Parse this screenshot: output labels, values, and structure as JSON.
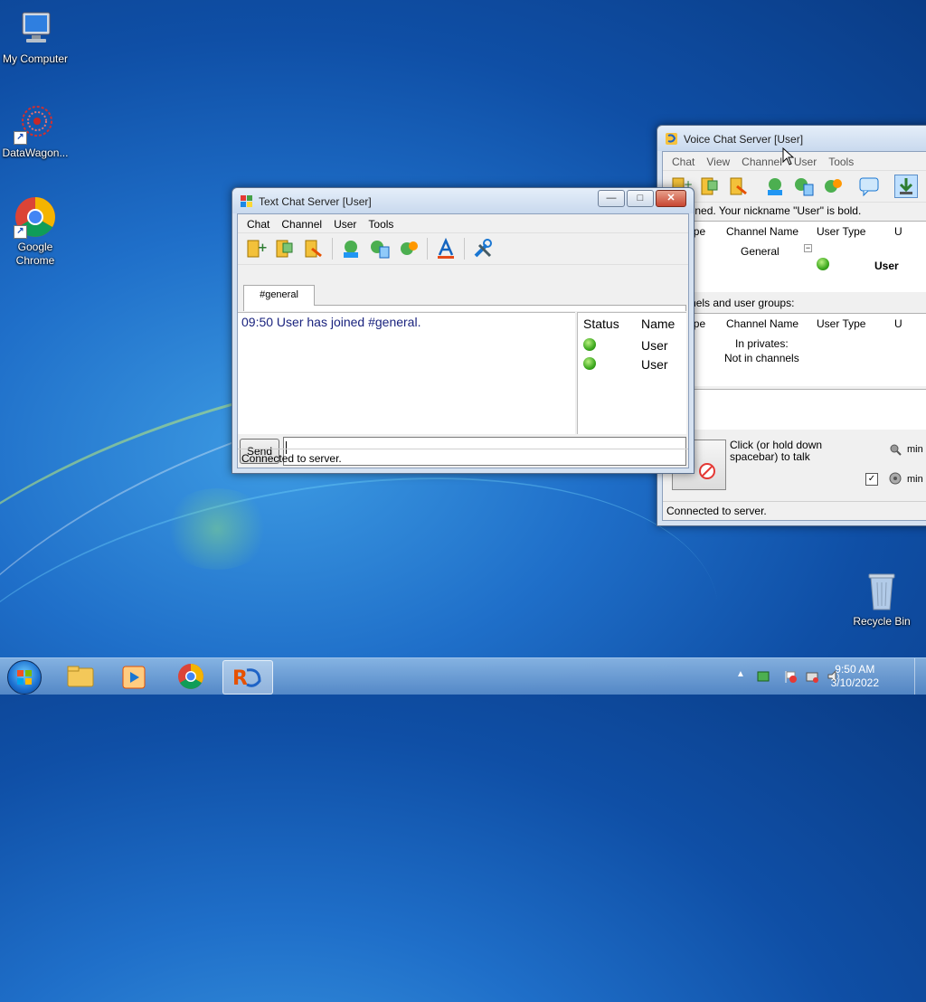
{
  "desktop": {
    "icons": [
      {
        "label": "My Computer"
      },
      {
        "label": "DataWagon..."
      },
      {
        "label": "Google Chrome"
      },
      {
        "label": "Recycle Bin"
      }
    ]
  },
  "text_chat": {
    "title": "Text Chat Server [User]",
    "menu": [
      "Chat",
      "Channel",
      "User",
      "Tools"
    ],
    "tab": "#general",
    "messages": [
      "09:50 User has joined #general."
    ],
    "users_header": {
      "status": "Status",
      "name": "Name"
    },
    "users": [
      {
        "name": "User"
      },
      {
        "name": "User"
      }
    ],
    "send_label": "Send",
    "input_value": "",
    "status": "Connected to server.",
    "window_buttons": {
      "minimize": "—",
      "maximize": "□",
      "close": "✕"
    }
  },
  "voice_chat": {
    "title": "Voice Chat Server [User]",
    "menu": [
      "Chat",
      "View",
      "Channel",
      "User",
      "Tools"
    ],
    "info_top": "nel joined. Your nickname \"User\" is bold.",
    "grid1_headers": {
      "type": "nel Type",
      "channel": "Channel Name",
      "user_type": "User Type",
      "extra": "U"
    },
    "grid1_channel": "General",
    "grid1_user": "User",
    "info_mid": "channels and user groups:",
    "grid2_headers": {
      "type": "nel Type",
      "channel": "Channel Name",
      "user_type": "User Type",
      "extra": "U"
    },
    "grid2_line1": "In privates:",
    "grid2_line2": "Not in channels",
    "talk_hint": "Click (or  hold down spacebar) to talk",
    "min1": "min",
    "min2": "min",
    "status": "Connected to server."
  },
  "taskbar": {
    "time": "9:50 AM",
    "date": "3/10/2022",
    "tray_expand": "▲"
  }
}
